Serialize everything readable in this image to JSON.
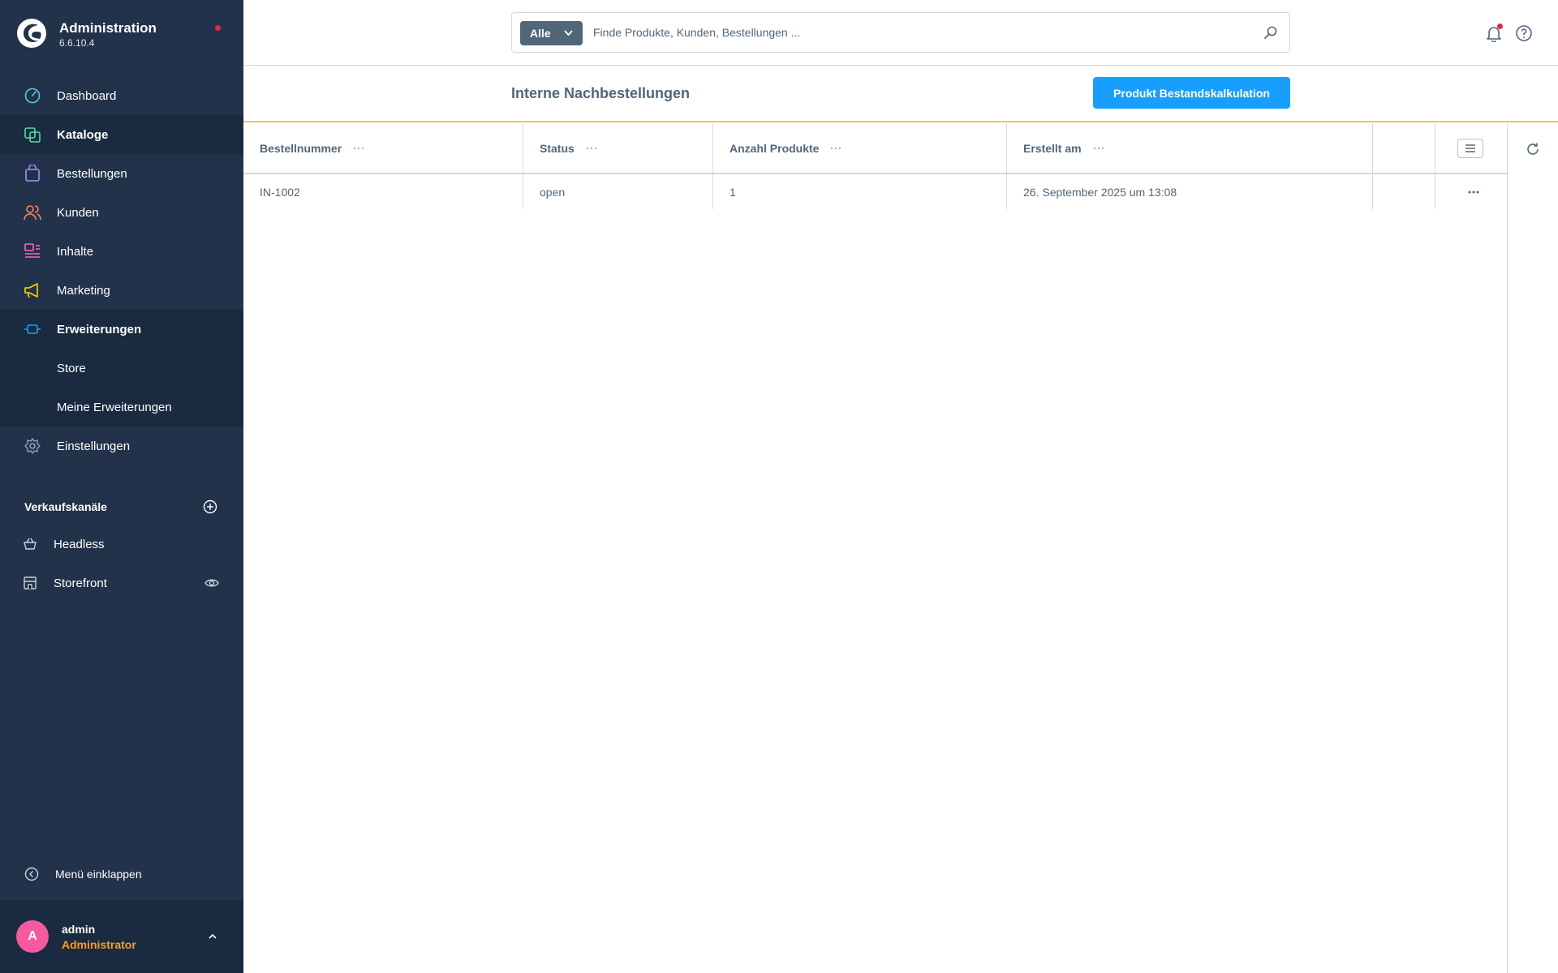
{
  "brand": {
    "title": "Administration",
    "version": "6.6.10.4"
  },
  "nav": {
    "items": [
      {
        "label": "Dashboard",
        "icon": "dashboard-icon"
      },
      {
        "label": "Kataloge",
        "icon": "catalog-icon"
      },
      {
        "label": "Bestellungen",
        "icon": "orders-icon"
      },
      {
        "label": "Kunden",
        "icon": "customers-icon"
      },
      {
        "label": "Inhalte",
        "icon": "content-icon"
      },
      {
        "label": "Marketing",
        "icon": "marketing-icon"
      },
      {
        "label": "Erweiterungen",
        "icon": "extensions-icon"
      },
      {
        "label": "Einstellungen",
        "icon": "settings-icon"
      }
    ],
    "sub_items": [
      {
        "label": "Store"
      },
      {
        "label": "Meine Erweiterungen"
      }
    ]
  },
  "channels": {
    "title": "Verkaufskanäle",
    "items": [
      {
        "label": "Headless",
        "icon": "basket-icon"
      },
      {
        "label": "Storefront",
        "icon": "storefront-icon"
      }
    ]
  },
  "collapse_label": "Menü einklappen",
  "user": {
    "initial": "A",
    "name": "admin",
    "role": "Administrator"
  },
  "search": {
    "type_label": "Alle",
    "placeholder": "Finde Produkte, Kunden, Bestellungen ..."
  },
  "page": {
    "title": "Interne Nachbestellungen",
    "primary_button": "Produkt Bestandskalkulation"
  },
  "grid": {
    "columns": [
      "Bestellnummer",
      "Status",
      "Anzahl Produkte",
      "Erstellt am"
    ],
    "rows": [
      {
        "order_number": "IN-1002",
        "status": "open",
        "product_count": "1",
        "created_at": "26. September 2025 um 13:08"
      }
    ]
  },
  "colors": {
    "sidebar": "#22324a",
    "sidebar_active": "#192a41",
    "primary": "#189eff",
    "accent_line": "#ffbd5d",
    "notification": "#de294c",
    "avatar": "#f45a9f",
    "role": "#ff9c18"
  }
}
